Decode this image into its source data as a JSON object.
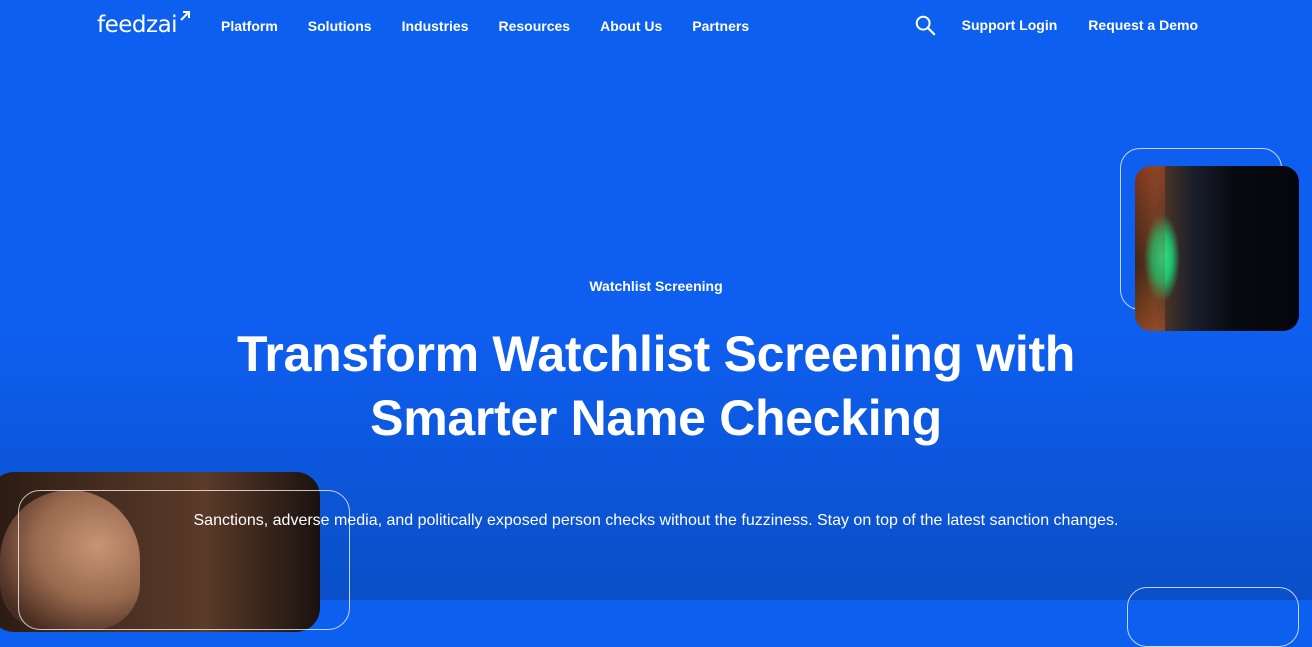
{
  "brand": {
    "name": "feedzai",
    "logo_icon": "arrow-up-right-icon"
  },
  "nav": {
    "items": [
      {
        "label": "Platform"
      },
      {
        "label": "Solutions"
      },
      {
        "label": "Industries"
      },
      {
        "label": "Resources"
      },
      {
        "label": "About Us"
      },
      {
        "label": "Partners"
      }
    ],
    "search_icon": "search-icon",
    "support_login": "Support Login",
    "request_demo": "Request a Demo"
  },
  "hero": {
    "eyebrow": "Watchlist Screening",
    "headline_line1": "Transform Watchlist Screening with",
    "headline_line2": "Smarter Name Checking",
    "subtitle": "Sanctions, adverse media, and politically exposed person checks without the fuzziness. Stay on top of the latest sanction changes."
  },
  "colors": {
    "background": "#0d60ef",
    "text": "#ffffff"
  }
}
